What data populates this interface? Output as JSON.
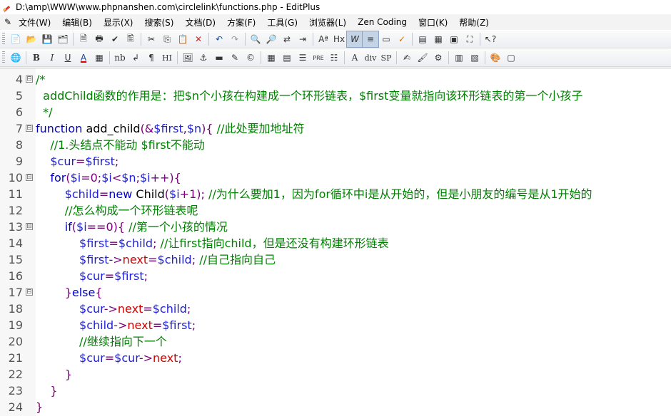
{
  "window": {
    "title": "D:\\amp\\WWW\\www.phpnanshen.com\\circlelink\\functions.php - EditPlus"
  },
  "menu": [
    "文件(W)",
    "编辑(B)",
    "显示(X)",
    "搜索(S)",
    "文档(D)",
    "方案(F)",
    "工具(G)",
    "浏览器(L)",
    "Zen Coding",
    "窗口(K)",
    "帮助(Z)"
  ],
  "toolbar2_labels": {
    "bold": "B",
    "italic": "I",
    "underline": "U",
    "fontcolor": "A",
    "nb": "nb",
    "pre": "PRE",
    "div": "div",
    "sp": "SP",
    "hx": "Hx",
    "hi": "HI"
  },
  "code": [
    {
      "n": "4",
      "fold": "⊟",
      "t": [
        [
          "cmt",
          "/*"
        ]
      ]
    },
    {
      "n": "5",
      "t": [
        [
          "cmt",
          "  addChild函数的作用是：把$n个小孩在构建成一个环形链表，$first变量就指向该环形链表的第一个小孩子"
        ]
      ]
    },
    {
      "n": "6",
      "t": [
        [
          "cmt",
          "  */"
        ]
      ]
    },
    {
      "n": "7",
      "fold": "⊟",
      "t": [
        [
          "kw",
          "function "
        ],
        [
          "plain",
          "add_child"
        ],
        [
          "op",
          "(&"
        ],
        [
          "var",
          "$first"
        ],
        [
          "op",
          ","
        ],
        [
          "var",
          "$n"
        ],
        [
          "op",
          "){ "
        ],
        [
          "cmt",
          "//此处要加地址符"
        ]
      ]
    },
    {
      "n": "8",
      "t": [
        [
          "cmt",
          "    //1.头结点不能动 $first不能动"
        ]
      ]
    },
    {
      "n": "9",
      "t": [
        [
          "var",
          "    $cur"
        ],
        [
          "op",
          "="
        ],
        [
          "var",
          "$first"
        ],
        [
          "op",
          ";"
        ]
      ]
    },
    {
      "n": "10",
      "fold": "⊟",
      "t": [
        [
          "kw",
          "    for"
        ],
        [
          "op",
          "("
        ],
        [
          "var",
          "$i"
        ],
        [
          "op",
          "=0;"
        ],
        [
          "var",
          "$i"
        ],
        [
          "op",
          "<"
        ],
        [
          "var",
          "$n"
        ],
        [
          "op",
          ";"
        ],
        [
          "var",
          "$i"
        ],
        [
          "op",
          "++){"
        ]
      ]
    },
    {
      "n": "11",
      "t": [
        [
          "var",
          "        $child"
        ],
        [
          "op",
          "="
        ],
        [
          "kw",
          "new "
        ],
        [
          "plain",
          "Child"
        ],
        [
          "op",
          "("
        ],
        [
          "var",
          "$i"
        ],
        [
          "op",
          "+1); "
        ],
        [
          "cmt",
          "//为什么要加1，因为for循环中i是从开始的，但是小朋友的编号是从1开始的"
        ]
      ]
    },
    {
      "n": "12",
      "t": [
        [
          "cmt",
          "        //怎么构成一个环形链表呢"
        ]
      ]
    },
    {
      "n": "13",
      "fold": "⊟",
      "t": [
        [
          "kw",
          "        if"
        ],
        [
          "op",
          "("
        ],
        [
          "var",
          "$i"
        ],
        [
          "op",
          "==0){ "
        ],
        [
          "cmt",
          "//第一个小孩的情况"
        ]
      ]
    },
    {
      "n": "14",
      "t": [
        [
          "var",
          "            $first"
        ],
        [
          "op",
          "="
        ],
        [
          "var",
          "$child"
        ],
        [
          "op",
          "; "
        ],
        [
          "cmt",
          "//让first指向child，但是还没有构建环形链表"
        ]
      ]
    },
    {
      "n": "15",
      "t": [
        [
          "var",
          "            $first"
        ],
        [
          "op",
          "->"
        ],
        [
          "prop",
          "next"
        ],
        [
          "op",
          "="
        ],
        [
          "var",
          "$child"
        ],
        [
          "op",
          "; "
        ],
        [
          "cmt",
          "//自己指向自己"
        ]
      ]
    },
    {
      "n": "16",
      "t": [
        [
          "var",
          "            $cur"
        ],
        [
          "op",
          "="
        ],
        [
          "var",
          "$first"
        ],
        [
          "op",
          ";"
        ]
      ]
    },
    {
      "n": "17",
      "fold": "⊟",
      "t": [
        [
          "op",
          "        }"
        ],
        [
          "kw",
          "else"
        ],
        [
          "op",
          "{"
        ]
      ]
    },
    {
      "n": "18",
      "t": [
        [
          "var",
          "            $cur"
        ],
        [
          "op",
          "->"
        ],
        [
          "prop",
          "next"
        ],
        [
          "op",
          "="
        ],
        [
          "var",
          "$child"
        ],
        [
          "op",
          ";"
        ]
      ]
    },
    {
      "n": "19",
      "t": [
        [
          "var",
          "            $child"
        ],
        [
          "op",
          "->"
        ],
        [
          "prop",
          "next"
        ],
        [
          "op",
          "="
        ],
        [
          "var",
          "$first"
        ],
        [
          "op",
          ";"
        ]
      ]
    },
    {
      "n": "20",
      "t": [
        [
          "cmt",
          "            //继续指向下一个"
        ]
      ]
    },
    {
      "n": "21",
      "t": [
        [
          "var",
          "            $cur"
        ],
        [
          "op",
          "="
        ],
        [
          "var",
          "$cur"
        ],
        [
          "op",
          "->"
        ],
        [
          "prop",
          "next"
        ],
        [
          "op",
          ";"
        ]
      ]
    },
    {
      "n": "22",
      "t": [
        [
          "op",
          "        }"
        ]
      ]
    },
    {
      "n": "23",
      "t": [
        [
          "op",
          "    }"
        ]
      ]
    },
    {
      "n": "24",
      "t": [
        [
          "op",
          "}"
        ]
      ]
    }
  ]
}
